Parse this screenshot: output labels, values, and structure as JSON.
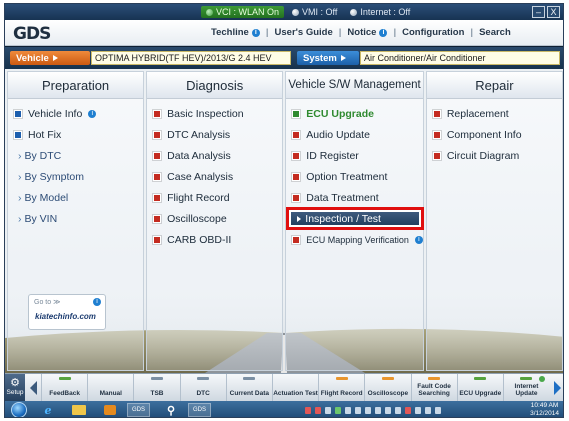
{
  "status": {
    "vci": "VCI : WLAN On",
    "vmi": "VMI : Off",
    "internet": "Internet : Off"
  },
  "window_controls": {
    "minimize": "–",
    "close": "X"
  },
  "header": {
    "logo": "GDS",
    "menu": [
      {
        "label": "Techline",
        "info": true
      },
      {
        "label": "User's Guide",
        "info": false
      },
      {
        "label": "Notice",
        "info": true
      },
      {
        "label": "Configuration",
        "info": false
      },
      {
        "label": "Search",
        "info": false
      }
    ]
  },
  "vehicle_bar": {
    "vehicle_label": "Vehicle",
    "vehicle_value": "OPTIMA HYBRID(TF HEV)/2013/G 2.4 HEV",
    "system_label": "System",
    "system_value": "Air Conditioner/Air Conditioner"
  },
  "columns": {
    "preparation": {
      "title": "Preparation",
      "items": [
        "Vehicle Info",
        "Hot Fix",
        "By DTC",
        "By Symptom",
        "By Model",
        "By VIN"
      ]
    },
    "diagnosis": {
      "title": "Diagnosis",
      "items": [
        "Basic Inspection",
        "DTC Analysis",
        "Data Analysis",
        "Case Analysis",
        "Flight Record",
        "Oscilloscope",
        "CARB OBD-II"
      ]
    },
    "vehicle_sw": {
      "title": "Vehicle S/W Management",
      "items": [
        "ECU Upgrade",
        "Audio Update",
        "ID Register",
        "Option Treatment",
        "Data Treatment",
        "Inspection / Test",
        "ECU Mapping Verification"
      ]
    },
    "repair": {
      "title": "Repair",
      "items": [
        "Replacement",
        "Component Info",
        "Circuit Diagram"
      ]
    }
  },
  "promo": {
    "goto": "Go to ≫",
    "brand": "kiatechinfo.com"
  },
  "toolbar": {
    "setup": "Setup",
    "buttons": [
      "FeedBack",
      "Manual",
      "TSB",
      "DTC",
      "Current Data",
      "Actuation Test",
      "Flight Record",
      "Oscilloscope",
      "Fault Code Searching",
      "ECU Upgrade",
      "Internet Update"
    ]
  },
  "taskbar": {
    "ie": "e",
    "app1": "GDS",
    "app2": "GDS",
    "time": "10:49 AM",
    "date": "3/12/2014"
  }
}
